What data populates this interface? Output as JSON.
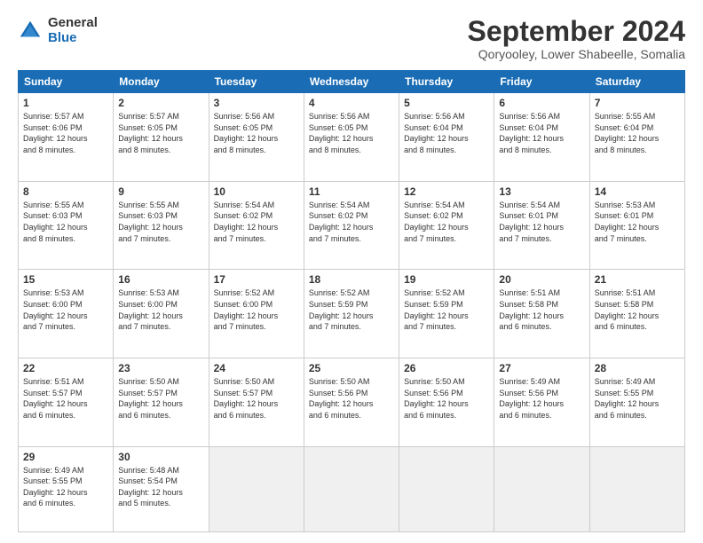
{
  "logo": {
    "general": "General",
    "blue": "Blue"
  },
  "title": "September 2024",
  "location": "Qoryooley, Lower Shabeelle, Somalia",
  "headers": [
    "Sunday",
    "Monday",
    "Tuesday",
    "Wednesday",
    "Thursday",
    "Friday",
    "Saturday"
  ],
  "weeks": [
    [
      {
        "day": "1",
        "info": "Sunrise: 5:57 AM\nSunset: 6:06 PM\nDaylight: 12 hours\nand 8 minutes."
      },
      {
        "day": "2",
        "info": "Sunrise: 5:57 AM\nSunset: 6:05 PM\nDaylight: 12 hours\nand 8 minutes."
      },
      {
        "day": "3",
        "info": "Sunrise: 5:56 AM\nSunset: 6:05 PM\nDaylight: 12 hours\nand 8 minutes."
      },
      {
        "day": "4",
        "info": "Sunrise: 5:56 AM\nSunset: 6:05 PM\nDaylight: 12 hours\nand 8 minutes."
      },
      {
        "day": "5",
        "info": "Sunrise: 5:56 AM\nSunset: 6:04 PM\nDaylight: 12 hours\nand 8 minutes."
      },
      {
        "day": "6",
        "info": "Sunrise: 5:56 AM\nSunset: 6:04 PM\nDaylight: 12 hours\nand 8 minutes."
      },
      {
        "day": "7",
        "info": "Sunrise: 5:55 AM\nSunset: 6:04 PM\nDaylight: 12 hours\nand 8 minutes."
      }
    ],
    [
      {
        "day": "8",
        "info": "Sunrise: 5:55 AM\nSunset: 6:03 PM\nDaylight: 12 hours\nand 8 minutes."
      },
      {
        "day": "9",
        "info": "Sunrise: 5:55 AM\nSunset: 6:03 PM\nDaylight: 12 hours\nand 7 minutes."
      },
      {
        "day": "10",
        "info": "Sunrise: 5:54 AM\nSunset: 6:02 PM\nDaylight: 12 hours\nand 7 minutes."
      },
      {
        "day": "11",
        "info": "Sunrise: 5:54 AM\nSunset: 6:02 PM\nDaylight: 12 hours\nand 7 minutes."
      },
      {
        "day": "12",
        "info": "Sunrise: 5:54 AM\nSunset: 6:02 PM\nDaylight: 12 hours\nand 7 minutes."
      },
      {
        "day": "13",
        "info": "Sunrise: 5:54 AM\nSunset: 6:01 PM\nDaylight: 12 hours\nand 7 minutes."
      },
      {
        "day": "14",
        "info": "Sunrise: 5:53 AM\nSunset: 6:01 PM\nDaylight: 12 hours\nand 7 minutes."
      }
    ],
    [
      {
        "day": "15",
        "info": "Sunrise: 5:53 AM\nSunset: 6:00 PM\nDaylight: 12 hours\nand 7 minutes."
      },
      {
        "day": "16",
        "info": "Sunrise: 5:53 AM\nSunset: 6:00 PM\nDaylight: 12 hours\nand 7 minutes."
      },
      {
        "day": "17",
        "info": "Sunrise: 5:52 AM\nSunset: 6:00 PM\nDaylight: 12 hours\nand 7 minutes."
      },
      {
        "day": "18",
        "info": "Sunrise: 5:52 AM\nSunset: 5:59 PM\nDaylight: 12 hours\nand 7 minutes."
      },
      {
        "day": "19",
        "info": "Sunrise: 5:52 AM\nSunset: 5:59 PM\nDaylight: 12 hours\nand 7 minutes."
      },
      {
        "day": "20",
        "info": "Sunrise: 5:51 AM\nSunset: 5:58 PM\nDaylight: 12 hours\nand 6 minutes."
      },
      {
        "day": "21",
        "info": "Sunrise: 5:51 AM\nSunset: 5:58 PM\nDaylight: 12 hours\nand 6 minutes."
      }
    ],
    [
      {
        "day": "22",
        "info": "Sunrise: 5:51 AM\nSunset: 5:57 PM\nDaylight: 12 hours\nand 6 minutes."
      },
      {
        "day": "23",
        "info": "Sunrise: 5:50 AM\nSunset: 5:57 PM\nDaylight: 12 hours\nand 6 minutes."
      },
      {
        "day": "24",
        "info": "Sunrise: 5:50 AM\nSunset: 5:57 PM\nDaylight: 12 hours\nand 6 minutes."
      },
      {
        "day": "25",
        "info": "Sunrise: 5:50 AM\nSunset: 5:56 PM\nDaylight: 12 hours\nand 6 minutes."
      },
      {
        "day": "26",
        "info": "Sunrise: 5:50 AM\nSunset: 5:56 PM\nDaylight: 12 hours\nand 6 minutes."
      },
      {
        "day": "27",
        "info": "Sunrise: 5:49 AM\nSunset: 5:56 PM\nDaylight: 12 hours\nand 6 minutes."
      },
      {
        "day": "28",
        "info": "Sunrise: 5:49 AM\nSunset: 5:55 PM\nDaylight: 12 hours\nand 6 minutes."
      }
    ],
    [
      {
        "day": "29",
        "info": "Sunrise: 5:49 AM\nSunset: 5:55 PM\nDaylight: 12 hours\nand 6 minutes."
      },
      {
        "day": "30",
        "info": "Sunrise: 5:48 AM\nSunset: 5:54 PM\nDaylight: 12 hours\nand 5 minutes."
      },
      {
        "day": "",
        "info": ""
      },
      {
        "day": "",
        "info": ""
      },
      {
        "day": "",
        "info": ""
      },
      {
        "day": "",
        "info": ""
      },
      {
        "day": "",
        "info": ""
      }
    ]
  ]
}
